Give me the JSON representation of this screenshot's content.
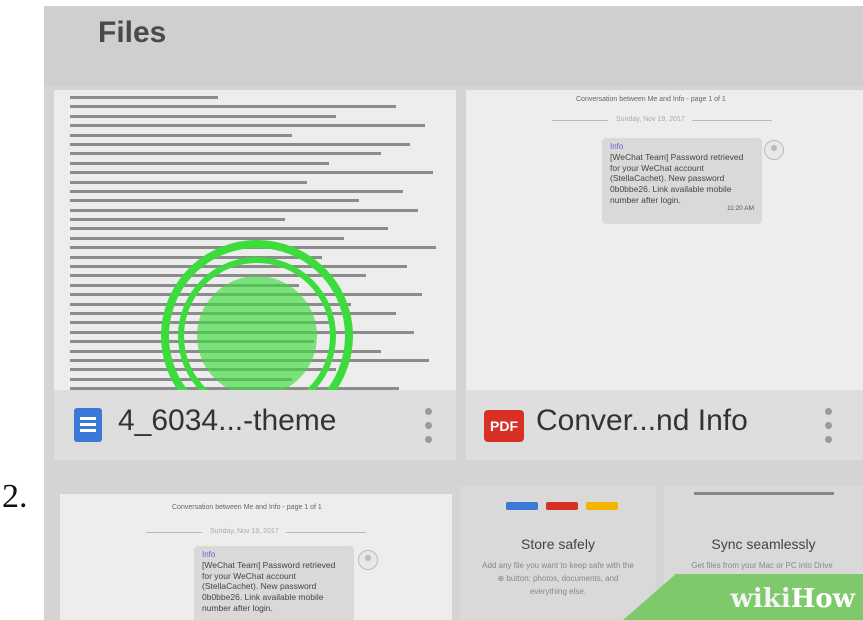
{
  "step_number": "2.",
  "header": {
    "title": "Files"
  },
  "files": [
    {
      "name": "4_6034...-theme",
      "icon": "google-docs-icon",
      "icon_color": "#3b78d8"
    },
    {
      "name": "Conver...nd Info",
      "icon": "pdf-icon",
      "icon_label": "PDF",
      "icon_color": "#d93025"
    }
  ],
  "chat_preview": {
    "title": "Conversation between Me and Info - page 1 of 1",
    "date": "Sunday, Nov 19, 2017",
    "sender": "Info",
    "message": "[WeChat Team] Password retrieved for your WeChat account (StellaCachet). New password 0b0bbe26. Link available mobile number after login.",
    "time": "11:20 AM"
  },
  "promos": [
    {
      "title": "Store safely",
      "description": "Add any file you want to keep safe with the ⊕ button: photos, documents, and everything else."
    },
    {
      "title": "Sync seamlessly",
      "description": "Get files from your Mac or PC into Drive using the desktop app. Download"
    }
  ],
  "promo_colors": [
    "#3b78d8",
    "#d93025",
    "#f4b400"
  ],
  "tap_indicator_color": "#3ddc3d",
  "watermark": {
    "wiki": "wiki",
    "how": "How"
  }
}
